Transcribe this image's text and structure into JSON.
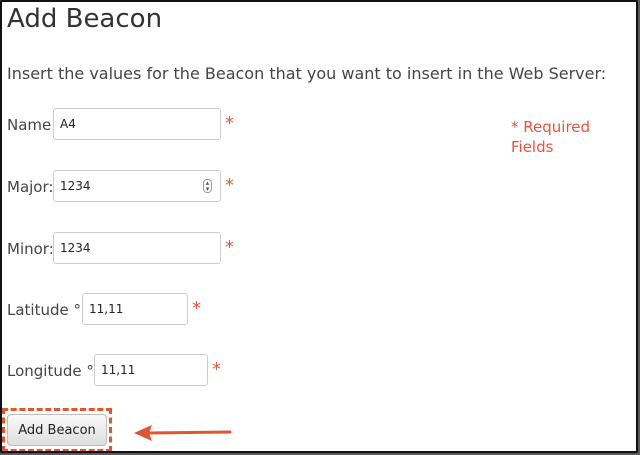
{
  "page": {
    "title": "Add Beacon",
    "intro": "Insert the values for the Beacon that you want to insert in the Web Server:",
    "required_note": "* Required Fields"
  },
  "form": {
    "name": {
      "label": "Name:",
      "value": "A4",
      "required_marker": "*"
    },
    "major": {
      "label": "Major:",
      "value": "1234",
      "required_marker": "*"
    },
    "minor": {
      "label": "Minor:",
      "value": "1234",
      "required_marker": "*"
    },
    "latitude": {
      "label": "Latitude ° :",
      "value": "11,11",
      "required_marker": "*"
    },
    "longitude": {
      "label": "Longitude ° :",
      "value": "11,11",
      "required_marker": "*"
    }
  },
  "actions": {
    "submit_label": "Add Beacon"
  },
  "colors": {
    "accent": "#e8553c",
    "highlight": "#e0562e"
  },
  "icons": {
    "spinner": "number-spinner-icon",
    "arrow": "left-arrow-icon"
  }
}
